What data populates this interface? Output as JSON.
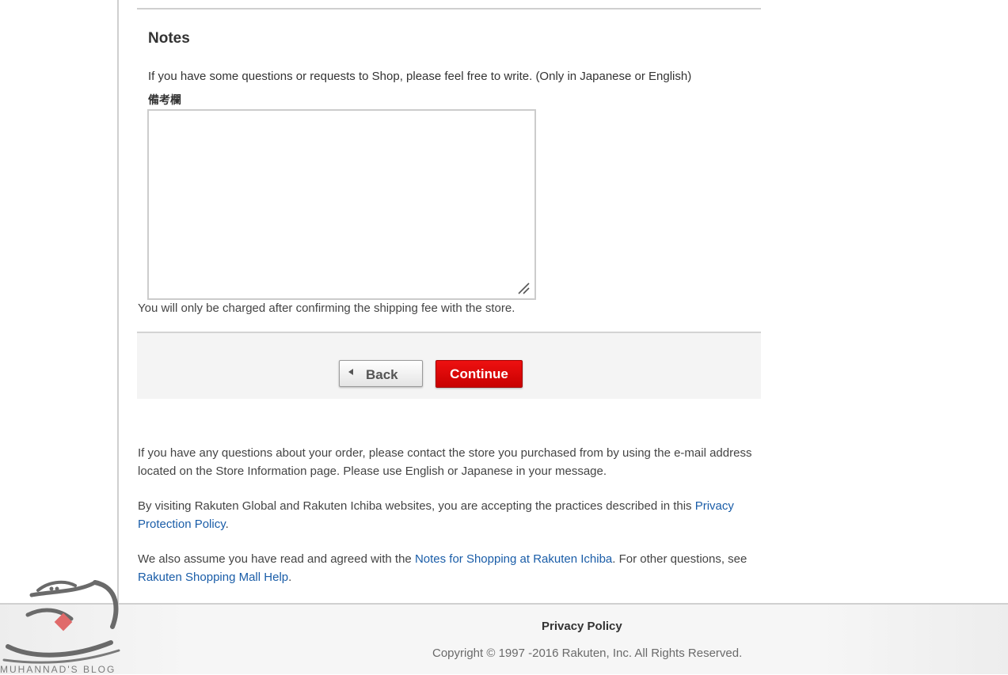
{
  "notes": {
    "title": "Notes",
    "description": "If you have some questions or requests to Shop, please feel free to write. (Only in Japanese or English)",
    "field_label": "備考欄",
    "textarea_value": "",
    "charge_note": "You will only be charged after confirming the shipping fee with the store."
  },
  "buttons": {
    "back_label": "Back",
    "continue_label": "Continue"
  },
  "info": {
    "contact_text": "If you have any questions about your order, please contact the store you purchased from by using the e-mail address located on the Store Information page. Please use English or Japanese in your message.",
    "privacy_prefix": "By visiting Rakuten Global and Rakuten Ichiba websites, you are accepting the practices described in this ",
    "privacy_link": "Privacy Protection Policy",
    "privacy_suffix": ".",
    "terms_prefix": "We also assume you have read and agreed with the ",
    "terms_link": "Notes for Shopping at Rakuten Ichiba",
    "terms_middle": ". For other questions, see ",
    "help_link": "Rakuten Shopping Mall Help",
    "terms_suffix": "."
  },
  "footer": {
    "privacy_policy": "Privacy Policy",
    "copyright": "Copyright © 1997 -2016 Rakuten, Inc. All Rights Reserved."
  },
  "watermark": {
    "text": "MUHANNAD'S BLOG"
  },
  "colors": {
    "link": "#1a5da8",
    "continue_button": "#dd0000",
    "rule": "#cfcfcf"
  },
  "icons": {
    "back_arrow": "triangle-left-icon",
    "resize_grip": "resize-grip-icon"
  }
}
